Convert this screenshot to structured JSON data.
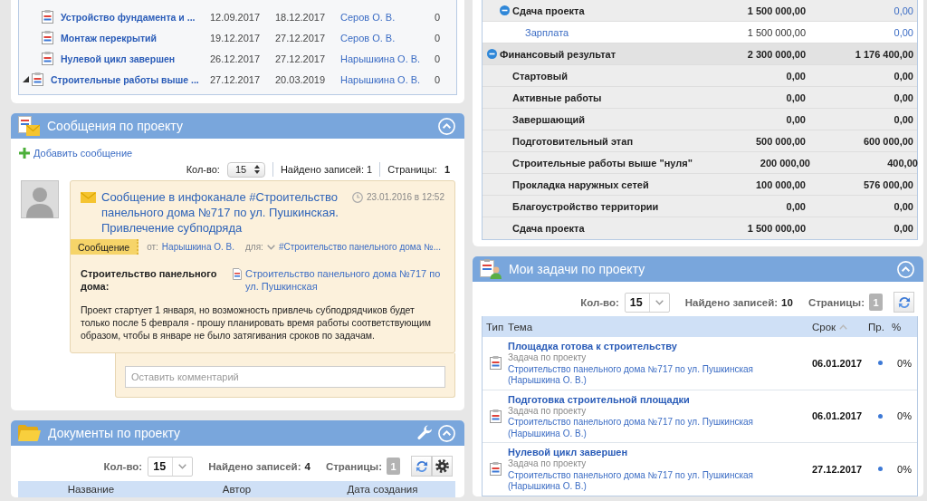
{
  "stages_table": {
    "rows": [
      {
        "kind": "task",
        "name": "Устройство фундамента и ...",
        "start": "12.09.2017",
        "end": "18.12.2017",
        "responsible": "Серов О. В.",
        "count": "0"
      },
      {
        "kind": "task",
        "name": "Монтаж перекрытий",
        "start": "19.12.2017",
        "end": "27.12.2017",
        "responsible": "Серов О. В.",
        "count": "0"
      },
      {
        "kind": "task",
        "name": "Нулевой цикл завершен",
        "start": "26.12.2017",
        "end": "27.12.2017",
        "responsible": "Нарышкина О. В.",
        "count": "0"
      },
      {
        "kind": "stage",
        "name": "Строительные работы выше ...",
        "start": "27.12.2017",
        "end": "20.03.2019",
        "responsible": "Нарышкина О. В.",
        "count": "0",
        "expanded": true
      }
    ]
  },
  "messages_panel": {
    "title": "Сообщения по проекту",
    "header_buttons": [
      {
        "kind": "collapse"
      }
    ],
    "add_link": "Добавить сообщение",
    "pager": {
      "kind": "compact",
      "count_label": "Кол-во:",
      "count": "15",
      "found_label": "Найдено записей:",
      "found": "1",
      "pages_label": "Страницы:",
      "pages": "1"
    },
    "messages": [
      {
        "title": "Сообщение в инфоканале #Строительство панельного дома №717 по ул. Пушкинская. Привлечение субподряда",
        "date": "23.01.2016 в 12:52",
        "tag": "Сообщение",
        "from_label": "от:",
        "from": "Нарышкина О. В.",
        "to_label": "для:",
        "to": "#Строительство панельного дома №...",
        "field_label": "Строительство панельного дома:",
        "field_value": "Строительство панельного дома №717 по ул. Пушкинская",
        "body": "Проект стартует 1 января, но возможность привлечь субподрядчиков будет только после 5 февраля - прошу планировать время работы соответствующим образом, чтобы в январе не было затягивания сроков по задачам.",
        "comment_placeholder": "Оставить комментарий"
      }
    ]
  },
  "documents_panel": {
    "title": "Документы по проекту",
    "header_buttons": [
      {
        "kind": "wrench"
      },
      {
        "kind": "collapse"
      }
    ],
    "pager": {
      "kind": "boxed",
      "count_label": "Кол-во:",
      "count": "15",
      "found_label": "Найдено записей:",
      "found": "4",
      "pages_label": "Страницы:",
      "pages": "1",
      "buttons": [
        {
          "kind": "refresh"
        },
        {
          "kind": "settings"
        }
      ]
    },
    "columns": [
      "Название",
      "Автор",
      "Дата создания"
    ]
  },
  "finance_table": {
    "rows": [
      {
        "kind": "subgroup",
        "name": "Сдача проекта",
        "plan": "1 500 000,00",
        "fact": "0,00",
        "expanded": true,
        "children": [
          {
            "kind": "article",
            "name": "Зарплата",
            "plan": "1 500 000,00",
            "fact": "0,00"
          }
        ]
      },
      {
        "kind": "group",
        "name": "Финансовый результат",
        "plan": "2 300 000,00",
        "fact": "1 176 400,00",
        "expanded": true,
        "children": [
          {
            "kind": "stage",
            "name": "Стартовый",
            "plan": "0,00",
            "fact": "0,00"
          },
          {
            "kind": "stage",
            "name": "Активные работы",
            "plan": "0,00",
            "fact": "0,00"
          },
          {
            "kind": "stage",
            "name": "Завершающий",
            "plan": "0,00",
            "fact": "0,00"
          },
          {
            "kind": "stage",
            "name": "Подготовительный этап",
            "plan": "500 000,00",
            "fact": "600 000,00"
          },
          {
            "kind": "stage",
            "name": "Строительные работы выше \"нуля\"",
            "plan": "200 000,00",
            "fact": "400,00"
          },
          {
            "kind": "stage",
            "name": "Прокладка наружных сетей",
            "plan": "100 000,00",
            "fact": "576 000,00"
          },
          {
            "kind": "stage",
            "name": "Благоустройство территории",
            "plan": "0,00",
            "fact": "0,00"
          },
          {
            "kind": "stage",
            "name": "Сдача проекта",
            "plan": "1 500 000,00",
            "fact": "0,00"
          }
        ]
      }
    ]
  },
  "tasks_panel": {
    "title": "Мои задачи по проекту",
    "header_buttons": [
      {
        "kind": "collapse"
      }
    ],
    "pager": {
      "kind": "boxed",
      "count_label": "Кол-во:",
      "count": "15",
      "found_label": "Найдено записей:",
      "found": "10",
      "pages_label": "Страницы:",
      "pages": "1",
      "buttons": [
        {
          "kind": "refresh"
        }
      ]
    },
    "columns": [
      {
        "label": "Тип",
        "sorted": false
      },
      {
        "label": "Тема",
        "sorted": false
      },
      {
        "label": "Срок",
        "sorted": true
      },
      {
        "label": "Пр.",
        "sorted": false
      },
      {
        "label": "%",
        "sorted": false
      }
    ],
    "rows": [
      {
        "title": "Площадка готова к строительству",
        "prefix": "Задача по проекту",
        "project": "Строительство панельного дома №717 по ул. Пушкинская",
        "owner": "(Нарышкина О. В.)",
        "due": "06.01.2017",
        "progress": "0%"
      },
      {
        "title": "Подготовка строительной площадки",
        "prefix": "Задача по проекту",
        "project": "Строительство панельного дома №717 по ул. Пушкинская",
        "owner": "(Нарышкина О. В.)",
        "due": "06.01.2017",
        "progress": "0%"
      },
      {
        "title": "Нулевой цикл завершен",
        "prefix": "Задача по проекту",
        "project": "Строительство панельного дома №717 по ул. Пушкинская",
        "owner": "(Нарышкина О. В.)",
        "due": "27.12.2017",
        "progress": "0%"
      }
    ]
  }
}
